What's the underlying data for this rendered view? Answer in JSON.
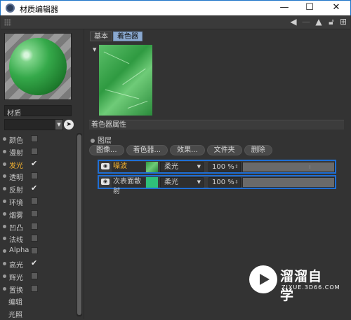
{
  "window": {
    "title": "材质编辑器",
    "minimize": "—",
    "maximize": "☐",
    "close": "✕"
  },
  "toolbar": {
    "icons": [
      "arrow-left-icon",
      "arrow-right-icon",
      "cursor-icon",
      "lock-icon",
      "new-window-icon"
    ]
  },
  "left": {
    "material_name": "材质",
    "channels": [
      {
        "label": "颜色",
        "checked": false,
        "active": false
      },
      {
        "label": "漫射",
        "checked": false,
        "active": false
      },
      {
        "label": "发光",
        "checked": true,
        "active": true
      },
      {
        "label": "透明",
        "checked": false,
        "active": false
      },
      {
        "label": "反射",
        "checked": true,
        "active": false
      },
      {
        "label": "环境",
        "checked": false,
        "active": false
      },
      {
        "label": "烟雾",
        "checked": false,
        "active": false
      },
      {
        "label": "凹凸",
        "checked": false,
        "active": false
      },
      {
        "label": "法线",
        "checked": false,
        "active": false
      },
      {
        "label": "Alpha",
        "checked": false,
        "active": false
      },
      {
        "label": "高光",
        "checked": true,
        "active": false
      },
      {
        "label": "辉光",
        "checked": false,
        "active": false
      },
      {
        "label": "置换",
        "checked": false,
        "active": false
      },
      {
        "label": "编辑",
        "checked": null,
        "active": false
      },
      {
        "label": "光照",
        "checked": null,
        "active": false
      }
    ]
  },
  "right": {
    "tabs": [
      "基本",
      "着色器"
    ],
    "section_title": "着色器属性",
    "layer_label": "图层",
    "buttons": [
      "图像...",
      "着色器...",
      "效果...",
      "文件夹",
      "删除"
    ],
    "layers": [
      {
        "name": "噪波",
        "blend": "柔光",
        "percent": "100 %",
        "active": true,
        "thumb_color": "#3aa84a"
      },
      {
        "name": "次表面散射",
        "blend": "柔光",
        "percent": "100 %",
        "active": false,
        "thumb_color": "#2fc07a"
      }
    ]
  },
  "watermark": {
    "brand": "溜溜自学",
    "url": "ZIXUE.3D66.COM"
  }
}
